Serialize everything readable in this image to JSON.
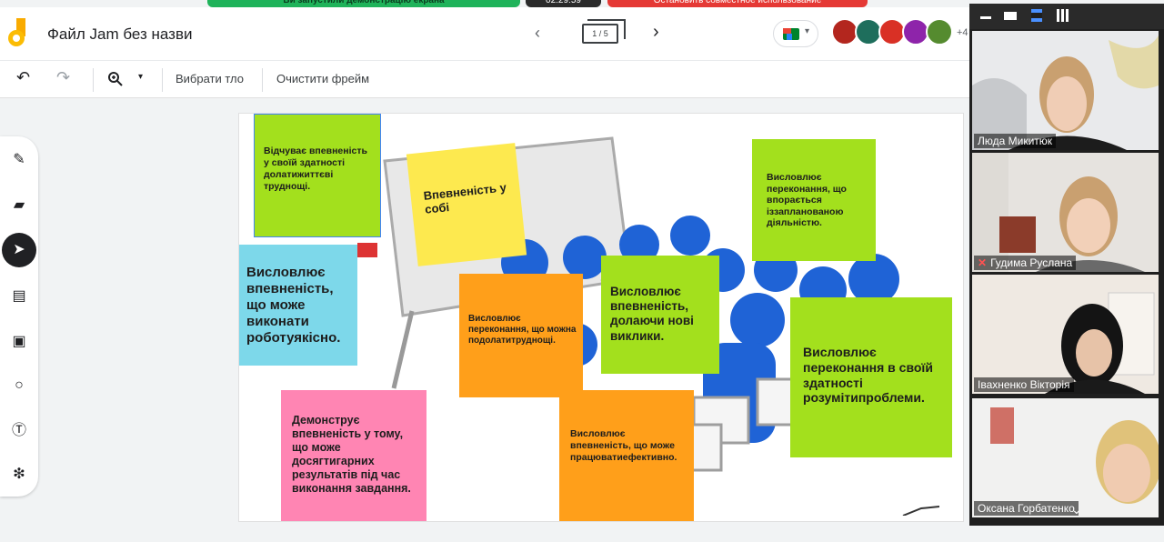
{
  "top_bar": {
    "share_status": "Ви запустили демонстрацію екрана",
    "timer": "02:29:59",
    "stop_label": "Остановить совместное использование"
  },
  "header": {
    "title": "Файл Jam без назви",
    "frame_indicator": "1 / 5",
    "participants_more": "+4"
  },
  "toolbar": {
    "bg_button": "Вибрати тло",
    "clear_button": "Очистити фрейм"
  },
  "tools": [
    "pen-icon",
    "eraser-icon",
    "select-icon",
    "sticky-note-icon",
    "image-icon",
    "circle-icon",
    "text-box-icon",
    "laser-icon"
  ],
  "notes": [
    {
      "id": "n1",
      "text": "Відчуває впевненість у своїй здатності долатижиттєві труднощі.",
      "color": "#a3e01d"
    },
    {
      "id": "n2",
      "text": "Впевненість у собі",
      "color": "#fde94f"
    },
    {
      "id": "n3",
      "text": "Висловлює переконання, що впорається іззапланованою діяльністю.",
      "color": "#a3e01d"
    },
    {
      "id": "n4",
      "text": "Висловлює впевненість, що може виконати роботуякісно.",
      "color": "#7dd8ea"
    },
    {
      "id": "n5",
      "text": "Висловлює переконання, що можна подолатитруднощі.",
      "color": "#ff9f1a"
    },
    {
      "id": "n6",
      "text": "Висловлює впевненість, долаючи нові виклики.",
      "color": "#a3e01d"
    },
    {
      "id": "n7",
      "text": "Висловлює переконання в своїй здатності розумітипроблеми.",
      "color": "#a3e01d"
    },
    {
      "id": "n8",
      "text": "Демонструє впевненість у тому, що може досягтигарних результатів під час виконання завдання.",
      "color": "#ff85b3"
    },
    {
      "id": "n9",
      "text": "Висловлює впевненість, що може працюватиефективно.",
      "color": "#ff9f1a"
    }
  ],
  "participants": [
    {
      "name": "Люда Микитюк",
      "muted": false
    },
    {
      "name": "Гудима Руслана",
      "muted": true
    },
    {
      "name": "Івахненко Вікторія",
      "muted": false
    },
    {
      "name": "Оксана Горбатенко",
      "muted": false
    }
  ],
  "colors": {
    "accent": "#1a73e8",
    "share_green": "#1fb35a",
    "stop_red": "#e53935"
  }
}
